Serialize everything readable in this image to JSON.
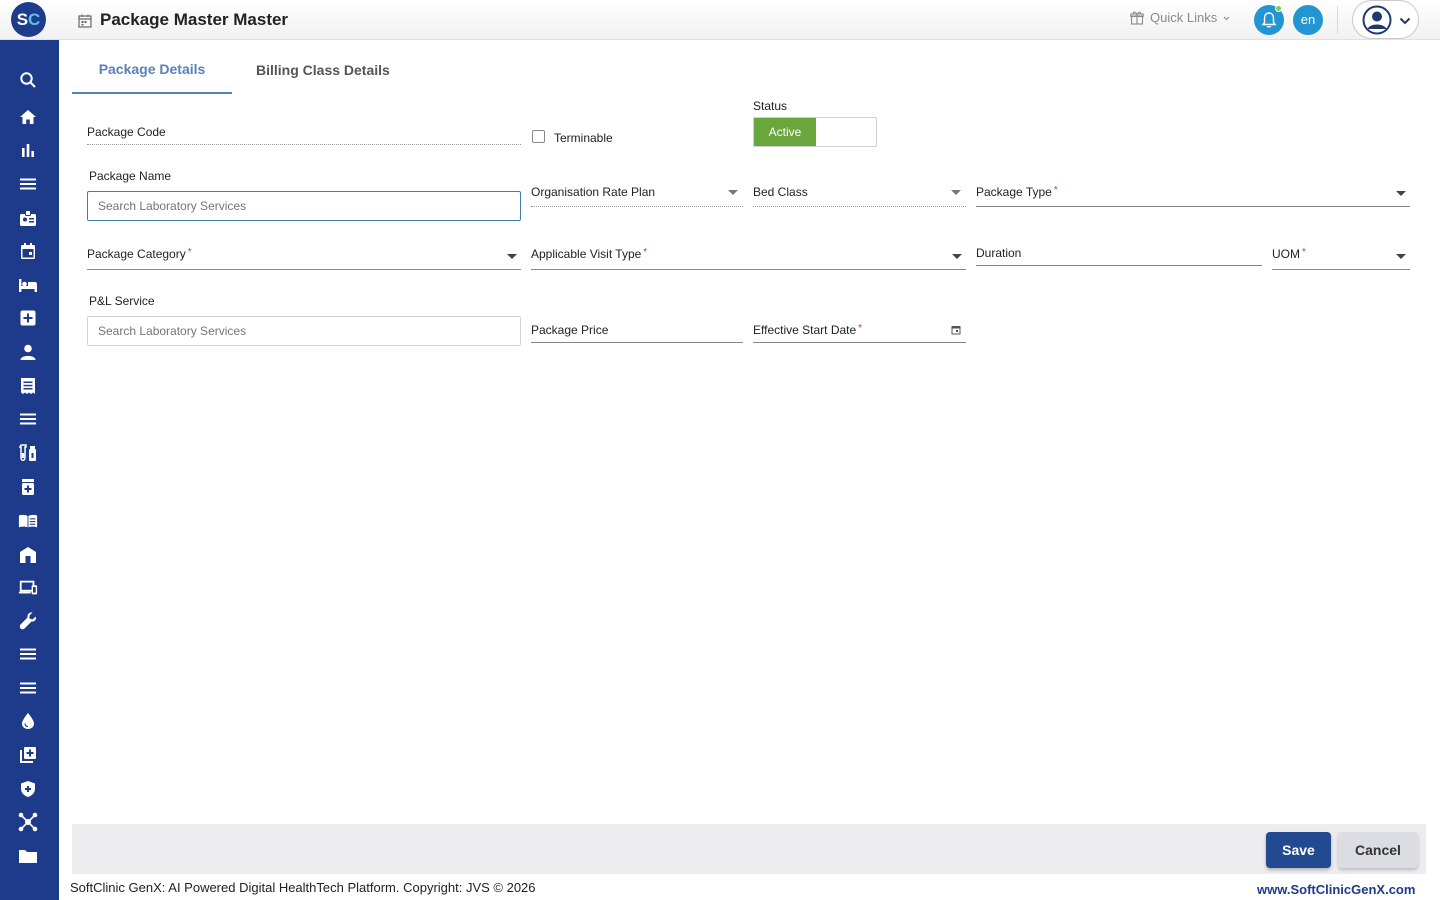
{
  "header": {
    "logo_s": "S",
    "logo_c": "C",
    "title": "Package Master Master",
    "quick_links": "Quick Links",
    "lang": "en"
  },
  "sidebar": {
    "icons": [
      "search-icon",
      "home-icon",
      "bar-chart-icon",
      "menu-icon",
      "id-badge-icon",
      "calendar-icon",
      "bed-icon",
      "medical-plus-icon",
      "person-icon",
      "receipt-icon",
      "list-icon",
      "lab-test-icon",
      "pharmacy-icon",
      "book-icon",
      "building-icon",
      "devices-icon",
      "wrench-icon",
      "menu-icon",
      "menu-icon",
      "drop-icon",
      "add-library-icon",
      "shield-icon",
      "network-icon",
      "folder-icon"
    ]
  },
  "tabs": {
    "package_details": "Package Details",
    "billing_class_details": "Billing Class Details"
  },
  "form": {
    "package_code": "Package Code",
    "terminable": "Terminable",
    "status_label": "Status",
    "status_value": "Active",
    "package_name": "Package Name",
    "package_name_placeholder": "Search Laboratory Services",
    "organisation_rate_plan": "Organisation Rate Plan",
    "bed_class": "Bed Class",
    "package_type": "Package Type",
    "package_category": "Package Category",
    "applicable_visit_type": "Applicable Visit Type",
    "duration": "Duration",
    "uom": "UOM",
    "pl_service": "P&L Service",
    "pl_service_placeholder": "Search Laboratory Services",
    "package_price": "Package Price",
    "effective_start_date": "Effective Start Date",
    "required_mark": "*"
  },
  "actions": {
    "save": "Save",
    "cancel": "Cancel"
  },
  "footer": {
    "copyright": "SoftClinic GenX: AI Powered Digital HealthTech Platform. Copyright: JVS © 2026",
    "website": "www.SoftClinicGenX.com"
  },
  "colors": {
    "sidebar": "#1e3a8a",
    "accent_tab": "#5a80b9",
    "status_active": "#6aa63c",
    "header_badge": "#2495d3",
    "save_button": "#234a91"
  }
}
